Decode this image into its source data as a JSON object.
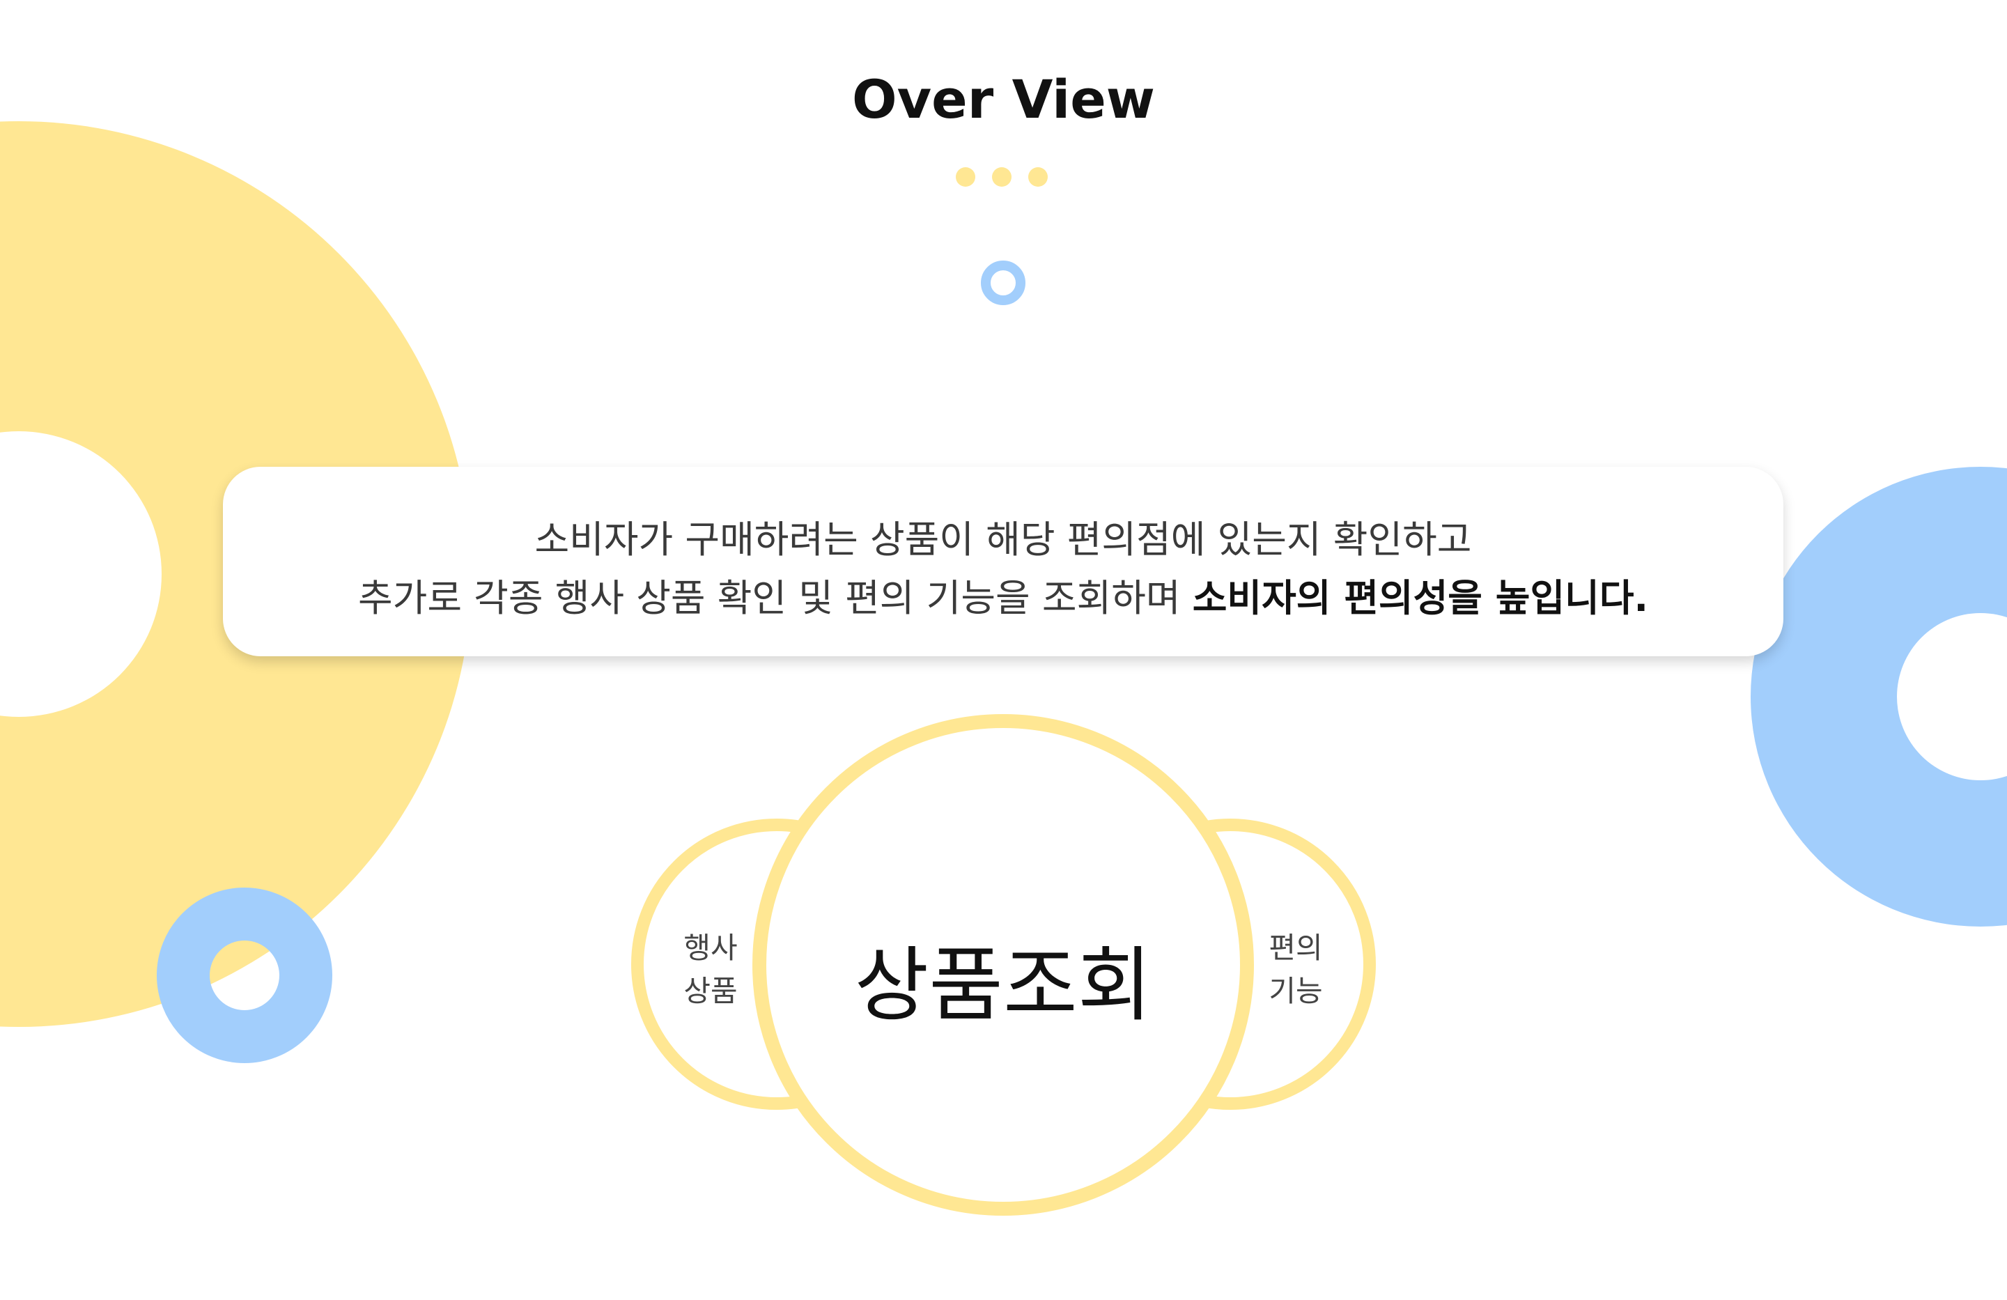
{
  "title": "Over View",
  "description": {
    "line1": "소비자가 구매하려는 상품이 해당 편의점에 있는지 확인하고",
    "line2_regular": "추가로 각종 행사 상품 확인 및 편의 기능을 조회하며 ",
    "line2_bold": "소비자의 편의성을 높입니다."
  },
  "diagram": {
    "center": "상품조회",
    "left": {
      "line1": "행사",
      "line2": "상품"
    },
    "right": {
      "line1": "편의",
      "line2": "기능"
    }
  },
  "colors": {
    "yellow": "#ffe793",
    "blue": "#a2cefc",
    "text": "#111111"
  }
}
